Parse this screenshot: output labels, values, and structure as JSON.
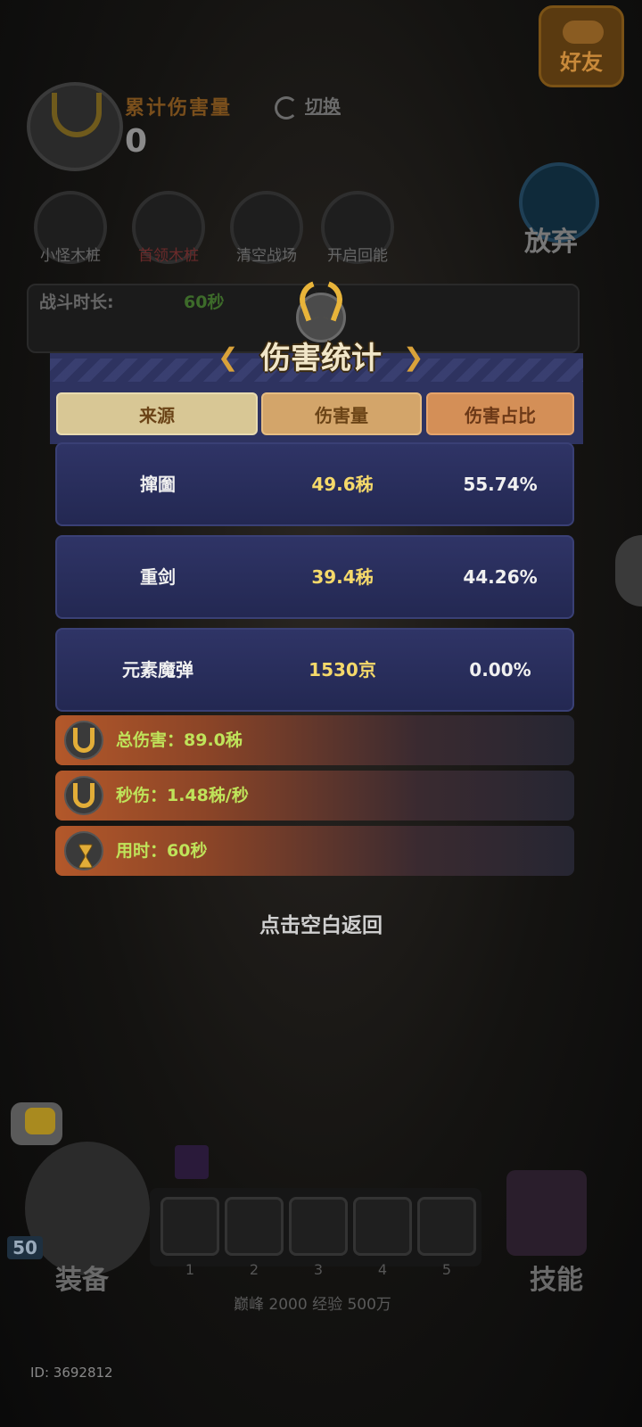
{
  "friends_button": {
    "label": "好友"
  },
  "damage_panel": {
    "label": "累计伤害量",
    "value": "0",
    "switch_label": "切换"
  },
  "tools": [
    {
      "label": "小怪木桩"
    },
    {
      "label": "首领木桩"
    },
    {
      "label": "清空战场"
    },
    {
      "label": "开启回能"
    }
  ],
  "give_up": {
    "label": "放弃"
  },
  "battle_timer": {
    "label": "战斗时长:",
    "value": "60秒"
  },
  "popup": {
    "title": "伤害统计",
    "columns": [
      "来源",
      "伤害量",
      "伤害占比"
    ],
    "rows": [
      {
        "source": "撺圗",
        "amount": "49.6秭",
        "share": "55.74%"
      },
      {
        "source": "重剑",
        "amount": "39.4秭",
        "share": "44.26%"
      },
      {
        "source": "元素魔弹",
        "amount": "1530京",
        "share": "0.00%"
      }
    ],
    "summary": [
      {
        "text": "总伤害：89.0秭",
        "icon": "horned-helmet-icon"
      },
      {
        "text": "秒伤：1.48秭/秒",
        "icon": "horned-helmet-icon"
      },
      {
        "text": "用时：60秒",
        "icon": "hourglass-icon"
      }
    ],
    "dismiss_hint": "点击空白返回"
  },
  "bottom": {
    "level": "50",
    "equip_label": "装备",
    "skill_label": "技能",
    "slots": [
      "1",
      "2",
      "3",
      "4",
      "5"
    ],
    "stats": "巅峰 2000   经验 500万",
    "player_id": "ID: 3692812"
  },
  "colors": {
    "panel_bg": "#2e3360",
    "header_col1": "#d8c795",
    "header_col2": "#d3a56a",
    "header_col3": "#d48f57",
    "amount_text": "#f5d96a",
    "summary_text": "#bfe35a",
    "title_gold": "#e8b43a"
  }
}
